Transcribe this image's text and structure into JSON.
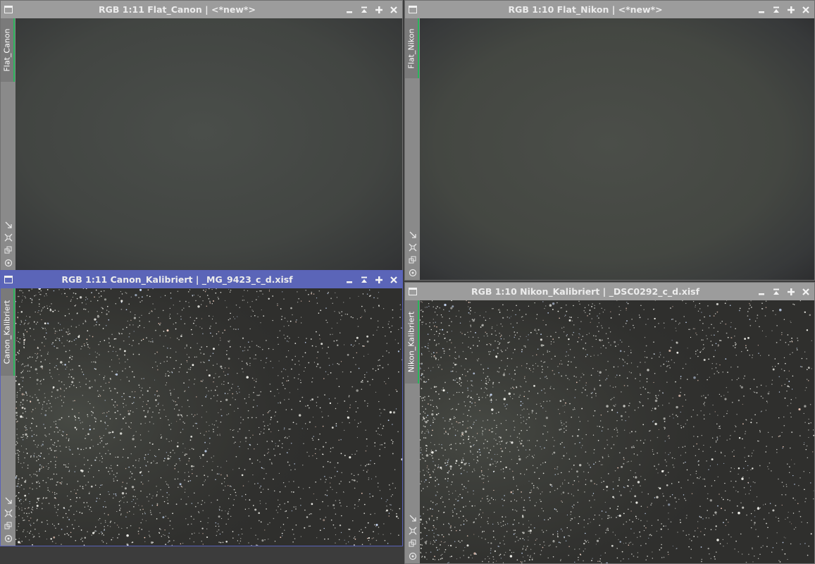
{
  "windows": [
    {
      "id": "flat-canon",
      "title": "RGB 1:11 Flat_Canon | <*new*>",
      "tab_label": "Flat_Canon",
      "image": "flat-field",
      "active": false
    },
    {
      "id": "flat-nikon",
      "title": "RGB 1:10 Flat_Nikon | <*new*>",
      "tab_label": "Flat_Nikon",
      "image": "flat-field",
      "active": false
    },
    {
      "id": "canon-kalibriert",
      "title": "RGB 1:11 Canon_Kalibriert | _MG_9423_c_d.xisf",
      "tab_label": "Canon_Kalibriert",
      "image": "star-field",
      "active": true
    },
    {
      "id": "nikon-kalibriert",
      "title": "RGB 1:10 Nikon_Kalibriert | _DSC0292_c_d.xisf",
      "tab_label": "Nikon_Kalibriert",
      "image": "star-field",
      "active": false
    }
  ],
  "icons": {
    "system": "window-menu-icon",
    "minimize": "minimize-icon",
    "shade": "shade-icon",
    "maximize": "maximize-icon",
    "close": "close-icon",
    "tools": [
      "zoom-fit-icon",
      "fit-view-icon",
      "clone-icon",
      "preview-icon"
    ]
  },
  "colors": {
    "active_titlebar": "#5b65b8",
    "inactive_titlebar": "#9c9c9c",
    "tab_accent": "#29b35a",
    "workspace": "#3c3c3c"
  }
}
